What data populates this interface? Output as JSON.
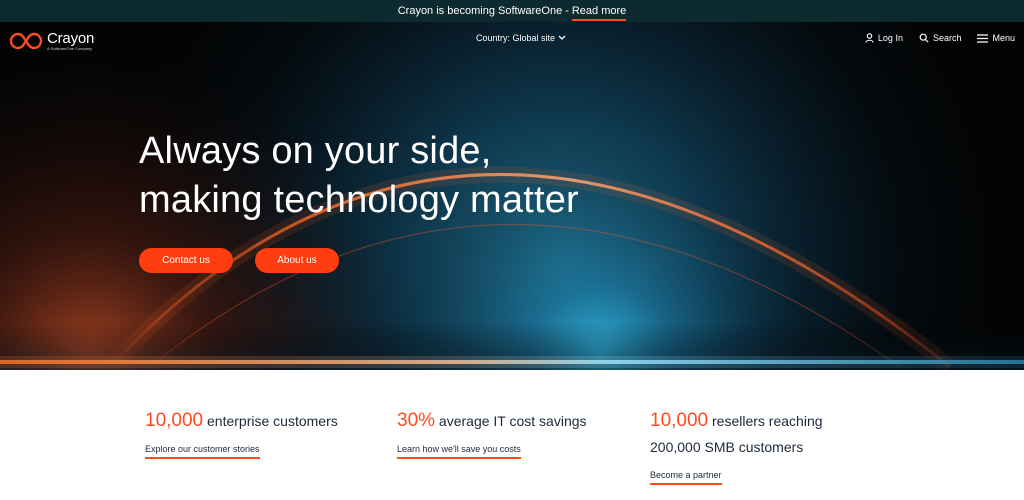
{
  "announcement": {
    "text": "Crayon is becoming SoftwareOne",
    "separator": "-",
    "link": "Read more"
  },
  "nav": {
    "logo_name": "Crayon",
    "logo_sub": "A SoftwareOne Company",
    "country": "Country: Global site",
    "login": "Log In",
    "search": "Search",
    "menu": "Menu"
  },
  "hero": {
    "headline_1": "Always on your side,",
    "headline_2": "making technology matter",
    "contact": "Contact us",
    "about": "About us"
  },
  "stats": [
    {
      "number": "10,000",
      "text": "enterprise customers",
      "link": "Explore our customer stories"
    },
    {
      "number": "30%",
      "text": "average IT cost savings",
      "link": "Learn how we'll save you costs"
    },
    {
      "number": "10,000",
      "text": "resellers reaching",
      "text2": "200,000 SMB customers",
      "link": "Become a partner"
    }
  ],
  "colors": {
    "accent": "#ff4b1f",
    "banner": "#0d2a2f",
    "hero_bg": "#030405",
    "text_dark": "#1d2a3a"
  },
  "icons": [
    "crayon-logo-icon",
    "chevron-down-icon",
    "user-icon",
    "search-icon",
    "menu-icon"
  ]
}
